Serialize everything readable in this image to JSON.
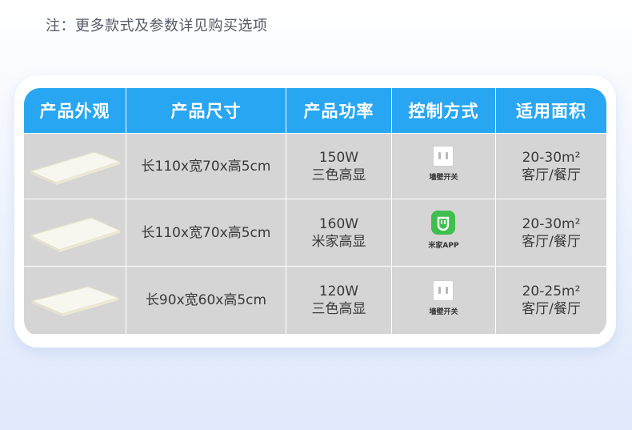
{
  "note": "注：更多款式及参数详见购买选项",
  "headers": [
    "产品外观",
    "产品尺寸",
    "产品功率",
    "控制方式",
    "适用面积"
  ],
  "rows": [
    {
      "size": "长110x宽70x高5cm",
      "power": "150W",
      "display": "三色高显",
      "control_icon": "wall-switch-icon",
      "control_label": "墙壁开关",
      "area": "20-30m²",
      "room": "客厅/餐厅"
    },
    {
      "size": "长110x宽70x高5cm",
      "power": "160W",
      "display": "米家高显",
      "control_icon": "mijia-app-icon",
      "control_label": "米家APP",
      "area": "20-30m²",
      "room": "客厅/餐厅"
    },
    {
      "size": "长90x宽60x高5cm",
      "power": "120W",
      "display": "三色高显",
      "control_icon": "wall-switch-icon",
      "control_label": "墙壁开关",
      "area": "20-25m²",
      "room": "客厅/餐厅"
    }
  ],
  "colors": {
    "header_bg": "#29a6f1",
    "row_bg": "#d5d5d5",
    "mijia_green": "#3fbf4d"
  }
}
